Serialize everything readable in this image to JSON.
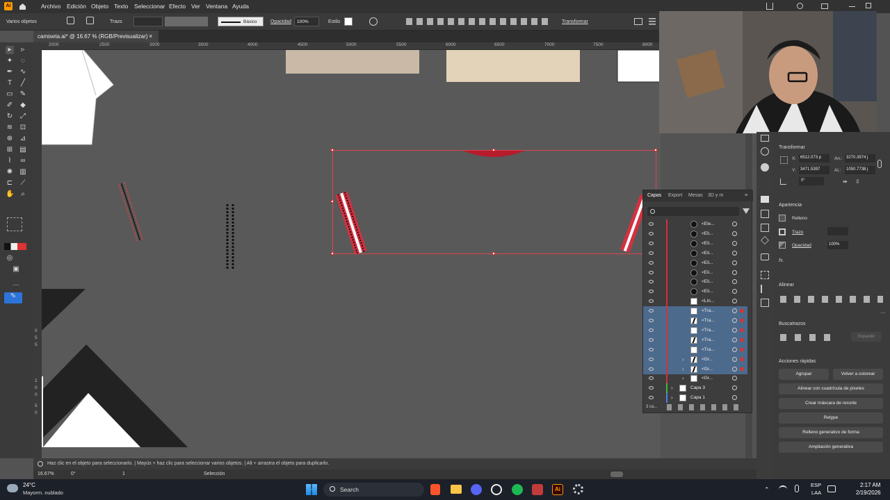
{
  "app": {
    "logo": "Ai",
    "home_icon": "home-icon"
  },
  "menu": [
    "Archivo",
    "Edición",
    "Objeto",
    "Texto",
    "Seleccionar",
    "Efecto",
    "Ver",
    "Ventana",
    "Ayuda"
  ],
  "control_bar": {
    "selection_label": "Varios objetos",
    "stroke_label": "Trazo",
    "stroke_style": "Básico",
    "opacity_label": "Opacidad",
    "opacity_value": "100%",
    "style_label": "Estilo",
    "transform_button": "Transformar"
  },
  "document": {
    "tab_title": "camiseta.ai* @ 16.67 % (RGB/Previsualizar)",
    "close_icon": "×"
  },
  "ruler_top": [
    "2000",
    "2500",
    "3000",
    "3500",
    "4000",
    "4500",
    "5000",
    "5500",
    "6000",
    "6500",
    "7000",
    "7500",
    "8000"
  ],
  "ruler_left": [
    "0",
    "5",
    "5",
    "2",
    "0",
    "0",
    "5",
    "0"
  ],
  "status_bar": {
    "hint": "Haz clic en el objeto para seleccionarlo. | Mayús + haz clic para seleccionar varios objetos. | Alt + arrastra el objeto para duplicarlo.",
    "zoom": "16.67%",
    "rotation": "0°",
    "artboard": "1",
    "tool_mode": "Selección"
  },
  "layers_panel": {
    "tabs": [
      "Capas",
      "Export",
      "Mesas",
      "3D y m"
    ],
    "search_placeholder": "",
    "rows": [
      {
        "name": "<Ele...",
        "selected": false,
        "thumb": "dark"
      },
      {
        "name": "<Eli...",
        "selected": false,
        "thumb": "dark"
      },
      {
        "name": "<Eli...",
        "selected": false,
        "thumb": "dark"
      },
      {
        "name": "<Eli...",
        "selected": false,
        "thumb": "dark"
      },
      {
        "name": "<Eli...",
        "selected": false,
        "thumb": "dark"
      },
      {
        "name": "<Eli...",
        "selected": false,
        "thumb": "dark"
      },
      {
        "name": "<Eli...",
        "selected": false,
        "thumb": "dark"
      },
      {
        "name": "<Eli...",
        "selected": false,
        "thumb": "dark"
      },
      {
        "name": "<Lín...",
        "selected": false,
        "thumb": "light"
      },
      {
        "name": "<Tra...",
        "selected": true,
        "thumb": "light"
      },
      {
        "name": "<Tra...",
        "selected": true,
        "thumb": "slash"
      },
      {
        "name": "<Tra...",
        "selected": true,
        "thumb": "light"
      },
      {
        "name": "<Tra...",
        "selected": true,
        "thumb": "slash"
      },
      {
        "name": "<Tra...",
        "selected": true,
        "thumb": "light"
      },
      {
        "name": "<Gr...",
        "selected": true,
        "thumb": "slash"
      },
      {
        "name": "<Gr...",
        "selected": true,
        "thumb": "slash"
      },
      {
        "name": "<Gr...",
        "selected": false,
        "thumb": "light"
      },
      {
        "name": "Capa 3",
        "selected": false,
        "thumb": "light"
      },
      {
        "name": "Capa 1",
        "selected": false,
        "thumb": "light"
      }
    ],
    "footer": "3 ca..."
  },
  "properties": {
    "transform_title": "Transformar",
    "x_label": "X:",
    "x_value": "6512.073 p",
    "w_label": "An.:",
    "w_value": "3270.3974 j",
    "y_label": "Y:",
    "y_value": "3471.5397",
    "h_label": "Al.:",
    "h_value": "1050.7738 j",
    "angle_value": "0°",
    "appearance_title": "Apariencia",
    "fill_label": "Relleno",
    "stroke_label": "Trazo",
    "opacity_label": "Opacidad",
    "opacity_value": "100%",
    "fx_label": "fx.",
    "align_title": "Alinear",
    "pathfinder_title": "Buscatrazos",
    "expand_label": "Expandir",
    "quick_actions_title": "Acciones rápidas",
    "btn_group": "Agrupar",
    "btn_recolor": "Volver a colorear",
    "btn_pixel_grid": "Alinear con cuadrícula de píxeles",
    "btn_clip_mask": "Crear máscara de recorte",
    "btn_retype": "Retype",
    "btn_gen_fill": "Relleno generativo de forma",
    "btn_gen_expand": "Ampliación generativa"
  },
  "taskbar": {
    "weather_temp": "24°C",
    "weather_desc": "Mayorm. nublado",
    "search_label": "Search",
    "lang": "ESP",
    "lang_sub": "LAA",
    "time": "2:17 AM",
    "date": "2/19/2026"
  },
  "colors": {
    "accent_red": "#d33040",
    "selection_blue": "#4c6a8c",
    "ai_orange": "#ff9a00"
  }
}
